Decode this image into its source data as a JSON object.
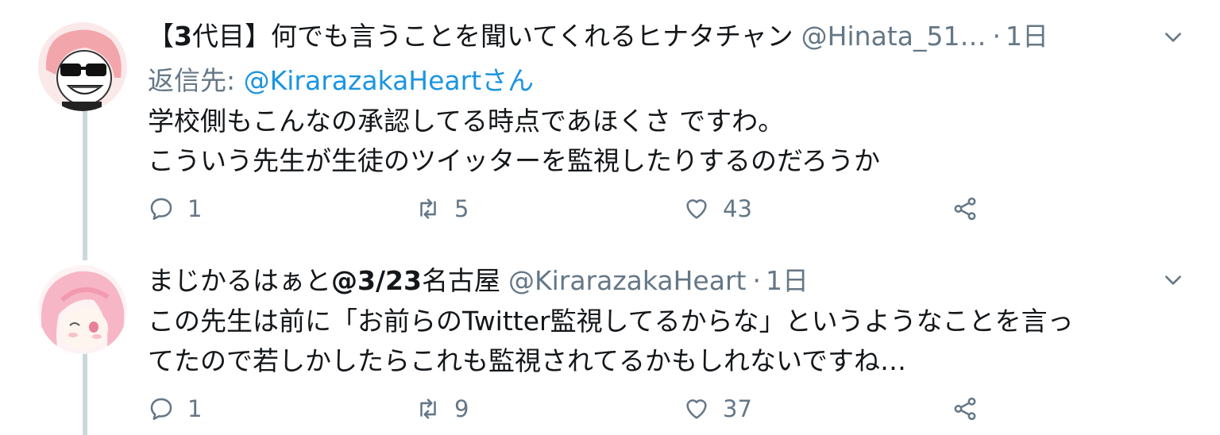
{
  "tweets": [
    {
      "display_name_prefix": "【",
      "display_name_bold": "3",
      "display_name_rest": "代目】何でも言うことを聞いてくれるヒナタチャン",
      "handle": "@Hinata_51…",
      "separator": "·",
      "time": "1日",
      "reply_label": "返信先: ",
      "reply_mention": "@KirarazakaHeartさん",
      "lines": [
        "学校側もこんなの承認してる時点であほくさ ですわ。",
        "こういう先生が生徒のツイッターを監視したりするのだろうか"
      ],
      "reply_count": "1",
      "retweet_count": "5",
      "like_count": "43"
    },
    {
      "display_name_prefix": "まじかるはぁと",
      "display_name_bold": "@3/23",
      "display_name_rest": "名古屋",
      "handle": "@KirarazakaHeart",
      "separator": "·",
      "time": "1日",
      "lines": [
        "この先生は前に「お前らのTwitter監視してるからな」というようなことを言っ",
        "てたので若しかしたらこれも監視されてるかもしれないですね…"
      ],
      "reply_count": "1",
      "retweet_count": "9",
      "like_count": "37"
    }
  ],
  "colors": {
    "text": "#14171a",
    "secondary": "#657786",
    "link": "#1b95e0",
    "thread_line": "#ccd6dd"
  },
  "icons": {
    "reply": "reply-icon",
    "retweet": "retweet-icon",
    "like": "heart-icon",
    "share": "share-icon",
    "menu": "chevron-down-icon"
  }
}
